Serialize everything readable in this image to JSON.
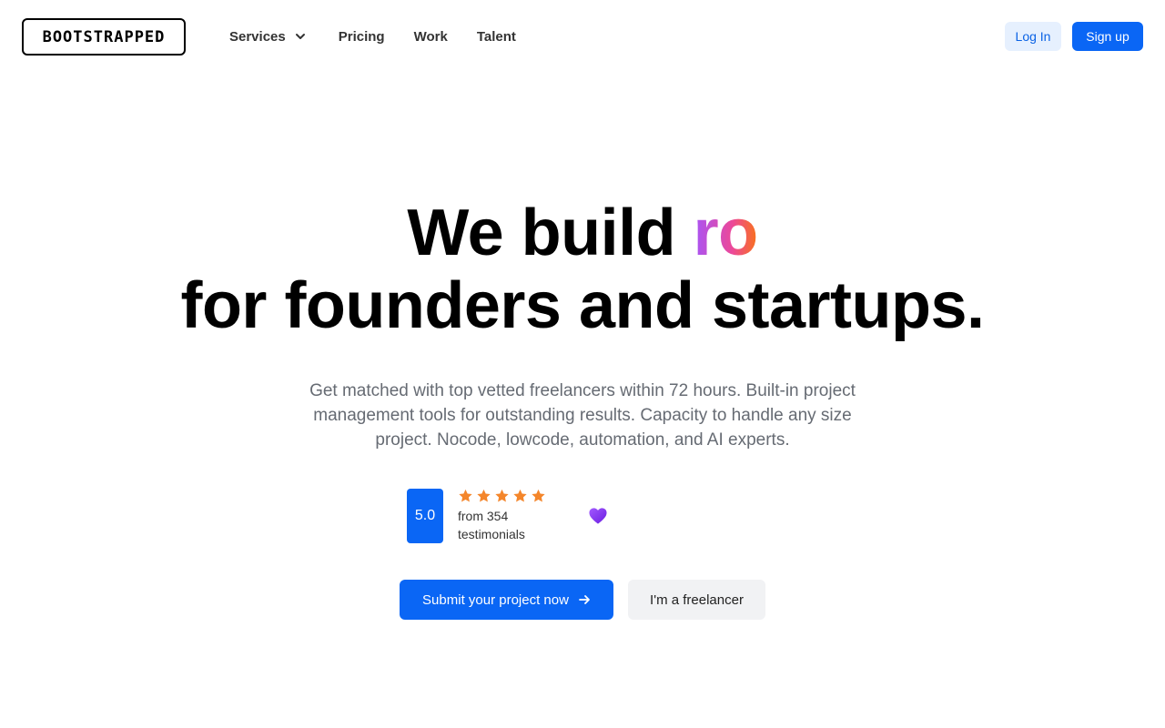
{
  "header": {
    "logo_text": "BOOTSTRAPPED",
    "nav": {
      "services": "Services",
      "pricing": "Pricing",
      "work": "Work",
      "talent": "Talent"
    },
    "login_label": "Log In",
    "signup_label": "Sign up"
  },
  "hero": {
    "headline_prefix": "We build ",
    "headline_highlight": "ro",
    "headline_line2": "for founders and startups.",
    "subtitle": "Get matched with top vetted freelancers within 72 hours. Built-in project management tools for outstanding results. Capacity to handle any size project. Nocode, lowcode, automation, and AI experts.",
    "rating": {
      "score": "5.0",
      "stars": 5,
      "text": "from 354 testimonials"
    },
    "cta_primary": "Submit your project now",
    "cta_secondary": "I'm a freelancer"
  },
  "colors": {
    "accent": "#0a66f5",
    "star": "#f4862b",
    "heart": "#7b2ff7"
  },
  "icons": [
    "chevron-down-icon",
    "star-icon",
    "heart-icon",
    "arrow-right-icon"
  ]
}
